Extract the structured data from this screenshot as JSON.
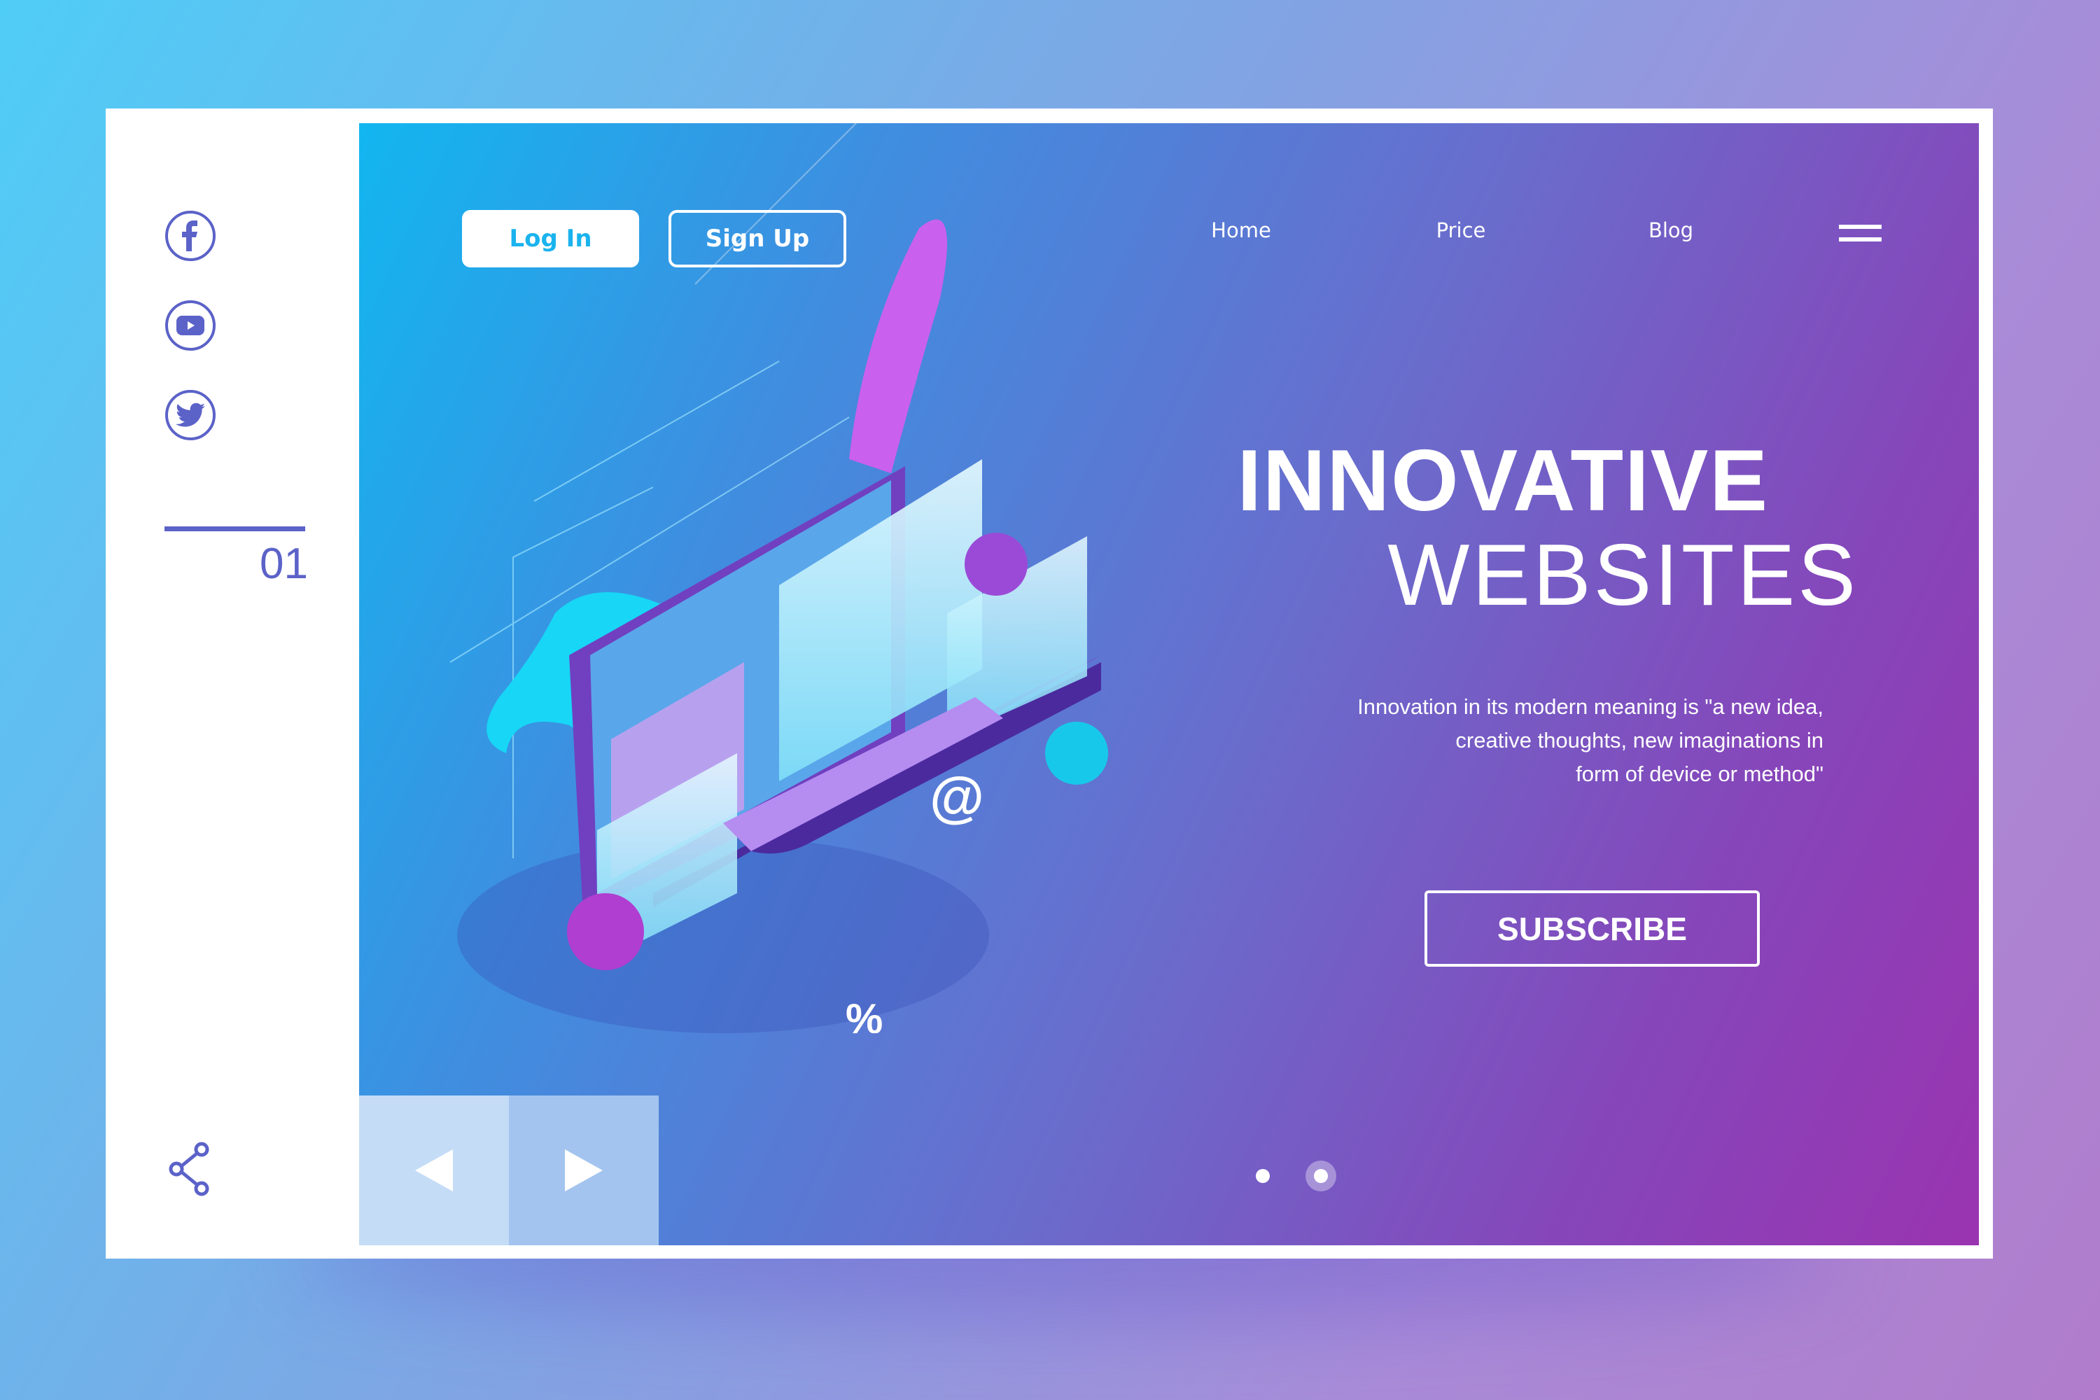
{
  "sidebar": {
    "social": [
      {
        "icon": "facebook-icon"
      },
      {
        "icon": "youtube-icon"
      },
      {
        "icon": "twitter-icon"
      }
    ],
    "slide_number": "01",
    "share_icon": "share-icon"
  },
  "header": {
    "login_label": "Log In",
    "signup_label": "Sign Up",
    "nav": [
      "Home",
      "Price",
      "Blog"
    ],
    "menu_icon": "hamburger-icon"
  },
  "hero": {
    "title_line1": "INNOVATIVE",
    "title_line2": "WEBSITES",
    "description": [
      "Innovation in its modern meaning is \"a new idea,",
      "creative thoughts, new imaginations in",
      "form of device or method\""
    ],
    "subscribe_label": "SUBSCRIBE",
    "illustration_symbols": {
      "at": "@",
      "percent": "%"
    }
  },
  "slider": {
    "dots": 2,
    "active_dot": 2,
    "prev_icon": "arrow-left-icon",
    "next_icon": "arrow-right-icon"
  },
  "colors": {
    "accent": "#5b62c8",
    "login_text": "#1bb3ee",
    "gradient_start": "#12b6f0",
    "gradient_end": "#9a34b0"
  }
}
